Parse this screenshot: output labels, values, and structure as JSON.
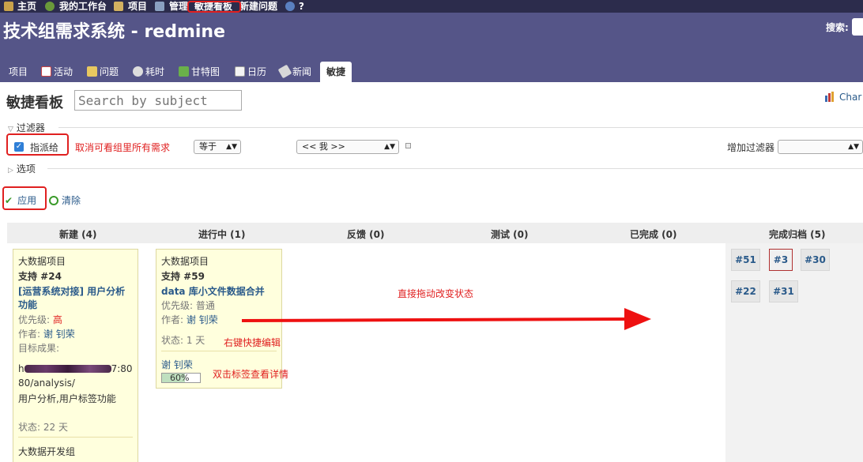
{
  "top_menu": {
    "items": [
      "主页",
      "我的工作台",
      "项目",
      "管理",
      "敏捷看板",
      "新建问题",
      "?"
    ]
  },
  "header": {
    "title": "技术组需求系统 - redmine",
    "search_label": "搜索:"
  },
  "tabs": [
    "项目",
    "活动",
    "问题",
    "耗时",
    "甘特图",
    "日历",
    "新闻",
    "敏捷"
  ],
  "page": {
    "title": "敏捷看板",
    "search_placeholder": "Search by subject",
    "chart_link": "Char"
  },
  "filters": {
    "legend": "过滤器",
    "assigned_label": "指派给",
    "annotation_cancel": "取消可看组里所有需求",
    "operator": "等于",
    "value": "<< 我 >>",
    "add_filter_label": "增加过滤器",
    "options_legend": "选项",
    "apply": "应用",
    "clear": "清除"
  },
  "board": {
    "columns": [
      "新建 (4)",
      "进行中 (1)",
      "反馈 (0)",
      "测试 (0)",
      "已完成 (0)",
      "完成归档 (5)"
    ],
    "cards": {
      "c1": {
        "project": "大数据项目",
        "tracker": "支持 #24",
        "subject_1": "[运营系统对接] 用户分析",
        "subject_2": "功能",
        "priority_label": "优先级:",
        "priority_value": "高",
        "author_label": "作者:",
        "author_value": "谢 钊荣",
        "target_label": "目标成果:",
        "url_prefix": "h",
        "url_suffix": "7:80",
        "url_line2": "80/analysis/",
        "desc": "用户分析,用户标签功能",
        "status": "状态: 22 天",
        "next_project": "大数据开发组"
      },
      "c2": {
        "project": "大数据项目",
        "tracker": "支持 #59",
        "subject": "data 库小文件数据合并",
        "priority_label": "优先级:",
        "priority_value": "普通",
        "author_label": "作者:",
        "author_value": "谢 钊荣",
        "status": "状态: 1 天",
        "assignee": "谢 钊荣",
        "progress_text": "60%",
        "progress": 0.6
      }
    },
    "done_chips": [
      "#51",
      "#3",
      "#30",
      "#22",
      "#31"
    ]
  },
  "annotations": {
    "drag": "直接拖动改变状态",
    "right_click": "右键快捷编辑",
    "double_click": "双击标签查看详情"
  },
  "colors": {
    "header_bg": "#555588",
    "top_bar_bg": "#2c2c4c",
    "card_bg": "#ffffdd",
    "link": "#2a5a8a",
    "annotation_red": "#e02020"
  }
}
